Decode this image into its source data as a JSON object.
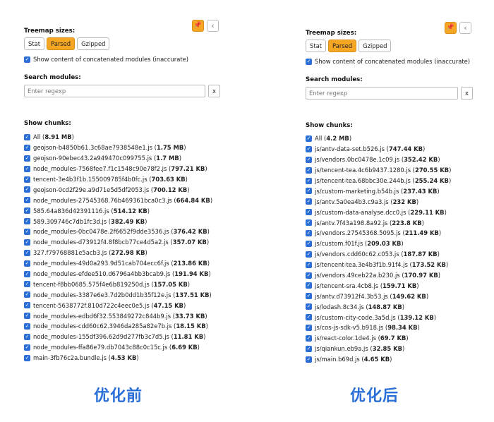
{
  "icons": {
    "pin": "pin-icon",
    "collapse": "chevron-left-icon",
    "checkbox": "checkbox-checked-icon"
  },
  "colors": {
    "accent": "#f5a623",
    "checkbox": "#2b6fd6",
    "caption": "#2a6fd8"
  },
  "before": {
    "caption": "优化前",
    "treemap_title": "Treemap sizes:",
    "size_buttons": [
      "Stat",
      "Parsed",
      "Gzipped"
    ],
    "active_size": "Parsed",
    "concat_label": "Show content of concatenated modules (inaccurate)",
    "search_title": "Search modules:",
    "search_placeholder": "Enter regexp",
    "clear_label": "x",
    "chunks_title": "Show chunks:",
    "chunks": [
      {
        "name": "All",
        "size": "8.91 MB"
      },
      {
        "name": "geojson-b4850b61.3c68ae7938548e1.js",
        "size": "1.75 MB"
      },
      {
        "name": "geojson-90ebec43.2a949470c099755.js",
        "size": "1.7 MB"
      },
      {
        "name": "node_modules-7568fee7.f1c1548c90e78f2.js",
        "size": "797.21 KB"
      },
      {
        "name": "tencent-3e4b3f1b.155009785f4b0fc.js",
        "size": "703.63 KB"
      },
      {
        "name": "geojson-0cd2f29e.a9d71e5d5df2053.js",
        "size": "700.12 KB"
      },
      {
        "name": "node_modules-27545368.76b469361bca0c3.js",
        "size": "664.84 KB"
      },
      {
        "name": "585.64a836d42391116.js",
        "size": "514.12 KB"
      },
      {
        "name": "589.309746c7db1fc3d.js",
        "size": "382.49 KB"
      },
      {
        "name": "node_modules-0bc0478e.2f6652f9dde3536.js",
        "size": "376.42 KB"
      },
      {
        "name": "node_modules-d73912f4.8f8bcb77ce4d5a2.js",
        "size": "357.07 KB"
      },
      {
        "name": "327.f79768881e5acb3.js",
        "size": "272.98 KB"
      },
      {
        "name": "node_modules-49d0a293.9d51cab704ecc6f.js",
        "size": "213.86 KB"
      },
      {
        "name": "node_modules-efdee510.d6796a4bb3bcab9.js",
        "size": "191.94 KB"
      },
      {
        "name": "tencent-f8bb0685.575f4e6b819250d.js",
        "size": "157.05 KB"
      },
      {
        "name": "node_modules-3387e6e3.7d2b0dd1b35f12e.js",
        "size": "137.51 KB"
      },
      {
        "name": "tencent-5638772f.810d722c4eec0e5.js",
        "size": "47.15 KB"
      },
      {
        "name": "node_modules-edbd6f32.553849272c844b9.js",
        "size": "33.73 KB"
      },
      {
        "name": "node_modules-cdd60c62.3946da285a82e7b.js",
        "size": "18.15 KB"
      },
      {
        "name": "node_modules-155df396.62d9d277fb3c7d5.js",
        "size": "11.81 KB"
      },
      {
        "name": "node_modules-ffa86e79.db7043c88c0c15c.js",
        "size": "6.69 KB"
      },
      {
        "name": "main-3fb76c2a.bundle.js",
        "size": "4.53 KB"
      }
    ]
  },
  "after": {
    "caption": "优化后",
    "treemap_title": "Treemap sizes:",
    "size_buttons": [
      "Stat",
      "Parsed",
      "Gzipped"
    ],
    "active_size": "Parsed",
    "concat_label": "Show content of concatenated modules (inaccurate)",
    "search_title": "Search modules:",
    "search_placeholder": "Enter regexp",
    "clear_label": "x",
    "chunks_title": "Show chunks:",
    "chunks": [
      {
        "name": "All",
        "size": "4.2 MB"
      },
      {
        "name": "js/antv-data-set.b526.js",
        "size": "747.44 KB"
      },
      {
        "name": "js/vendors.0bc0478e.1c09.js",
        "size": "352.42 KB"
      },
      {
        "name": "js/tencent-tea.4c6b9437.1280.js",
        "size": "270.55 KB"
      },
      {
        "name": "js/tencent-tea.68bbc30e.244b.js",
        "size": "255.24 KB"
      },
      {
        "name": "js/custom-marketing.b54b.js",
        "size": "237.43 KB"
      },
      {
        "name": "js/antv.5a0ea4b3.c9a3.js",
        "size": "232 KB"
      },
      {
        "name": "js/custom-data-analyse.dcc0.js",
        "size": "229.11 KB"
      },
      {
        "name": "js/antv.7f43a198.8a92.js",
        "size": "223.8 KB"
      },
      {
        "name": "js/vendors.27545368.5095.js",
        "size": "211.49 KB"
      },
      {
        "name": "js/custom.f01f.js",
        "size": "209.03 KB"
      },
      {
        "name": "js/vendors.cdd60c62.c053.js",
        "size": "187.87 KB"
      },
      {
        "name": "js/tencent-tea.3e4b3f1b.91f4.js",
        "size": "173.52 KB"
      },
      {
        "name": "js/vendors.49ceb22a.b230.js",
        "size": "170.97 KB"
      },
      {
        "name": "js/tencent-sra.4cb8.js",
        "size": "159.71 KB"
      },
      {
        "name": "js/antv.d73912f4.3b53.js",
        "size": "149.62 KB"
      },
      {
        "name": "js/lodash.8c34.js",
        "size": "148.87 KB"
      },
      {
        "name": "js/custom-city-code.3a5d.js",
        "size": "139.12 KB"
      },
      {
        "name": "js/cos-js-sdk-v5.b918.js",
        "size": "98.34 KB"
      },
      {
        "name": "js/react-color.1de4.js",
        "size": "69.7 KB"
      },
      {
        "name": "js/qiankun.eb9a.js",
        "size": "32.85 KB"
      },
      {
        "name": "js/main.b69d.js",
        "size": "4.65 KB"
      }
    ]
  }
}
